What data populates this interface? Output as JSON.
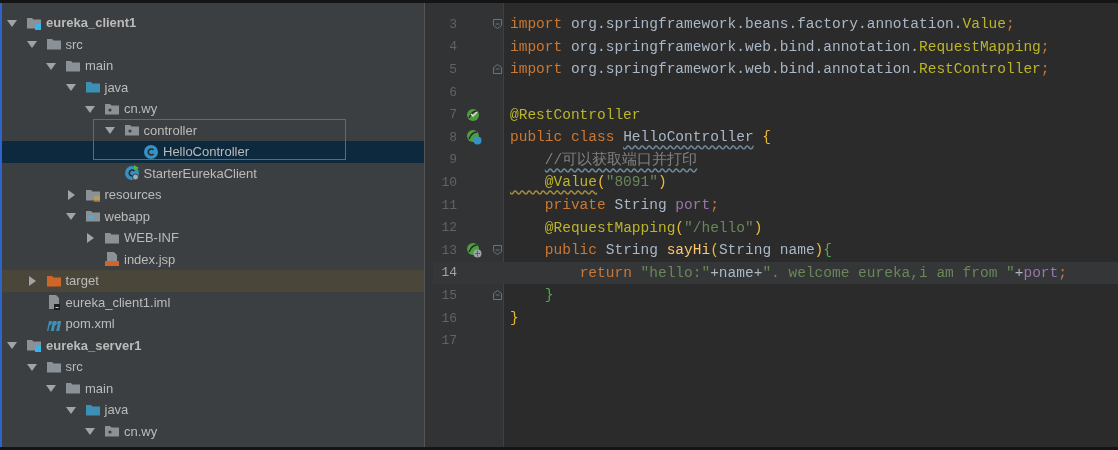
{
  "project_tree": {
    "items": [
      {
        "label": "eureka_client1",
        "kind": "module",
        "expanded": true,
        "selected": false,
        "excluded": false,
        "children": [
          {
            "label": "src",
            "kind": "folder",
            "expanded": true,
            "selected": false,
            "excluded": false,
            "children": [
              {
                "label": "main",
                "kind": "folder",
                "expanded": true,
                "selected": false,
                "excluded": false,
                "children": [
                  {
                    "label": "java",
                    "kind": "source",
                    "expanded": true,
                    "selected": false,
                    "excluded": false,
                    "children": [
                      {
                        "label": "cn.wy",
                        "kind": "package",
                        "expanded": true,
                        "selected": false,
                        "excluded": false,
                        "children": [
                          {
                            "label": "controller",
                            "kind": "package",
                            "expanded": true,
                            "selected": false,
                            "excluded": false,
                            "children": [
                              {
                                "label": "HelloController",
                                "kind": "class",
                                "selected": true,
                                "excluded": false
                              }
                            ]
                          },
                          {
                            "label": "StarterEurekaClient",
                            "kind": "boot-class",
                            "selected": false,
                            "excluded": false
                          }
                        ]
                      }
                    ]
                  },
                  {
                    "label": "resources",
                    "kind": "resources",
                    "expanded": false,
                    "selected": false,
                    "excluded": false
                  },
                  {
                    "label": "webapp",
                    "kind": "webapp",
                    "expanded": true,
                    "selected": false,
                    "excluded": false,
                    "children": [
                      {
                        "label": "WEB-INF",
                        "kind": "folder",
                        "expanded": false,
                        "selected": false,
                        "excluded": false
                      },
                      {
                        "label": "index.jsp",
                        "kind": "jsp",
                        "selected": false,
                        "excluded": false
                      }
                    ]
                  }
                ]
              }
            ]
          },
          {
            "label": "target",
            "kind": "excluded-folder",
            "expanded": false,
            "selected": false,
            "excluded": true
          },
          {
            "label": "eureka_client1.iml",
            "kind": "iml",
            "selected": false,
            "excluded": false
          },
          {
            "label": "pom.xml",
            "kind": "maven",
            "selected": false,
            "excluded": false
          }
        ]
      },
      {
        "label": "eureka_server1",
        "kind": "module",
        "expanded": true,
        "selected": false,
        "excluded": false,
        "children": [
          {
            "label": "src",
            "kind": "folder",
            "expanded": true,
            "selected": false,
            "excluded": false,
            "children": [
              {
                "label": "main",
                "kind": "folder",
                "expanded": true,
                "selected": false,
                "excluded": false,
                "children": [
                  {
                    "label": "java",
                    "kind": "source",
                    "expanded": true,
                    "selected": false,
                    "excluded": false,
                    "children": [
                      {
                        "label": "cn.wy",
                        "kind": "package",
                        "expanded": true,
                        "selected": false,
                        "excluded": false
                      }
                    ]
                  }
                ]
              }
            ]
          }
        ]
      }
    ]
  },
  "editor": {
    "lines": [
      {
        "number": "3",
        "current": false,
        "fold": {
          "kind": "start"
        },
        "segments": [
          {
            "kind": "keyword",
            "text": "import"
          },
          {
            "kind": "plain",
            "text": " org.springframework.beans.factory.annotation."
          },
          {
            "kind": "annotation",
            "text": "Value"
          },
          {
            "kind": "keyword",
            "text": ";"
          }
        ]
      },
      {
        "number": "4",
        "current": false,
        "segments": [
          {
            "kind": "keyword",
            "text": "import"
          },
          {
            "kind": "plain",
            "text": " org.springframework.web.bind.annotation."
          },
          {
            "kind": "annotation",
            "text": "RequestMapping"
          },
          {
            "kind": "keyword",
            "text": ";"
          }
        ]
      },
      {
        "number": "5",
        "current": false,
        "fold": {
          "kind": "end"
        },
        "segments": [
          {
            "kind": "keyword",
            "text": "import"
          },
          {
            "kind": "plain",
            "text": " org.springframework.web.bind.annotation."
          },
          {
            "kind": "annotation",
            "text": "RestController"
          },
          {
            "kind": "keyword",
            "text": ";"
          }
        ]
      },
      {
        "number": "6",
        "current": false
      },
      {
        "number": "7",
        "current": false,
        "gutter_icon": {
          "kind": "bean"
        },
        "segments": [
          {
            "kind": "annotation",
            "text": "@RestController"
          }
        ]
      },
      {
        "number": "8",
        "current": false,
        "gutter_icon": {
          "kind": "bean-class"
        },
        "segments": [
          {
            "kind": "keyword",
            "text": "public class "
          },
          {
            "kind": "plain",
            "text": "HelloController",
            "squiggle": {
              "kind": "typo"
            }
          },
          {
            "kind": "bracket1",
            "text": " {"
          }
        ]
      },
      {
        "number": "9",
        "current": false,
        "segments": [
          {
            "kind": "comment",
            "text": "    //可以获取端口并打印",
            "squiggle": {
              "kind": "typo"
            }
          }
        ]
      },
      {
        "number": "10",
        "current": false,
        "segments": [
          {
            "kind": "annotation",
            "text": "    @Value",
            "squiggle": {
              "kind": "warning"
            }
          },
          {
            "kind": "bracket1",
            "text": "("
          },
          {
            "kind": "string",
            "text": "\"8091\""
          },
          {
            "kind": "bracket1",
            "text": ")"
          }
        ]
      },
      {
        "number": "11",
        "current": false,
        "segments": [
          {
            "kind": "keyword",
            "text": "    private "
          },
          {
            "kind": "plain",
            "text": "String "
          },
          {
            "kind": "field",
            "text": "port"
          },
          {
            "kind": "keyword",
            "text": ";"
          }
        ]
      },
      {
        "number": "12",
        "current": false,
        "segments": [
          {
            "kind": "annotation",
            "text": "    @RequestMapping"
          },
          {
            "kind": "bracket1",
            "text": "("
          },
          {
            "kind": "string",
            "text": "\"/hello\""
          },
          {
            "kind": "bracket1",
            "text": ")"
          }
        ]
      },
      {
        "number": "13",
        "current": false,
        "gutter_icon": {
          "kind": "bean-web"
        },
        "fold": {
          "kind": "start"
        },
        "segments": [
          {
            "kind": "keyword",
            "text": "    public "
          },
          {
            "kind": "plain",
            "text": "String "
          },
          {
            "kind": "method",
            "text": "sayHi"
          },
          {
            "kind": "bracket1",
            "text": "("
          },
          {
            "kind": "plain",
            "text": "String name"
          },
          {
            "kind": "bracket1",
            "text": ")"
          },
          {
            "kind": "bracket2",
            "text": "{"
          }
        ]
      },
      {
        "number": "14",
        "current": true,
        "segments": [
          {
            "kind": "keyword",
            "text": "        return "
          },
          {
            "kind": "string",
            "text": "\"hello:\""
          },
          {
            "kind": "plain",
            "text": "+name+"
          },
          {
            "kind": "string",
            "text": "\". welcome eureka,i am from \""
          },
          {
            "kind": "plain",
            "text": "+"
          },
          {
            "kind": "field",
            "text": "port"
          },
          {
            "kind": "keyword",
            "text": ";"
          }
        ]
      },
      {
        "number": "15",
        "current": false,
        "fold": {
          "kind": "end"
        },
        "segments": [
          {
            "kind": "bracket2",
            "text": "    }"
          }
        ]
      },
      {
        "number": "16",
        "current": false,
        "segments": [
          {
            "kind": "bracket1",
            "text": "}"
          }
        ]
      },
      {
        "number": "17",
        "current": false
      }
    ]
  }
}
